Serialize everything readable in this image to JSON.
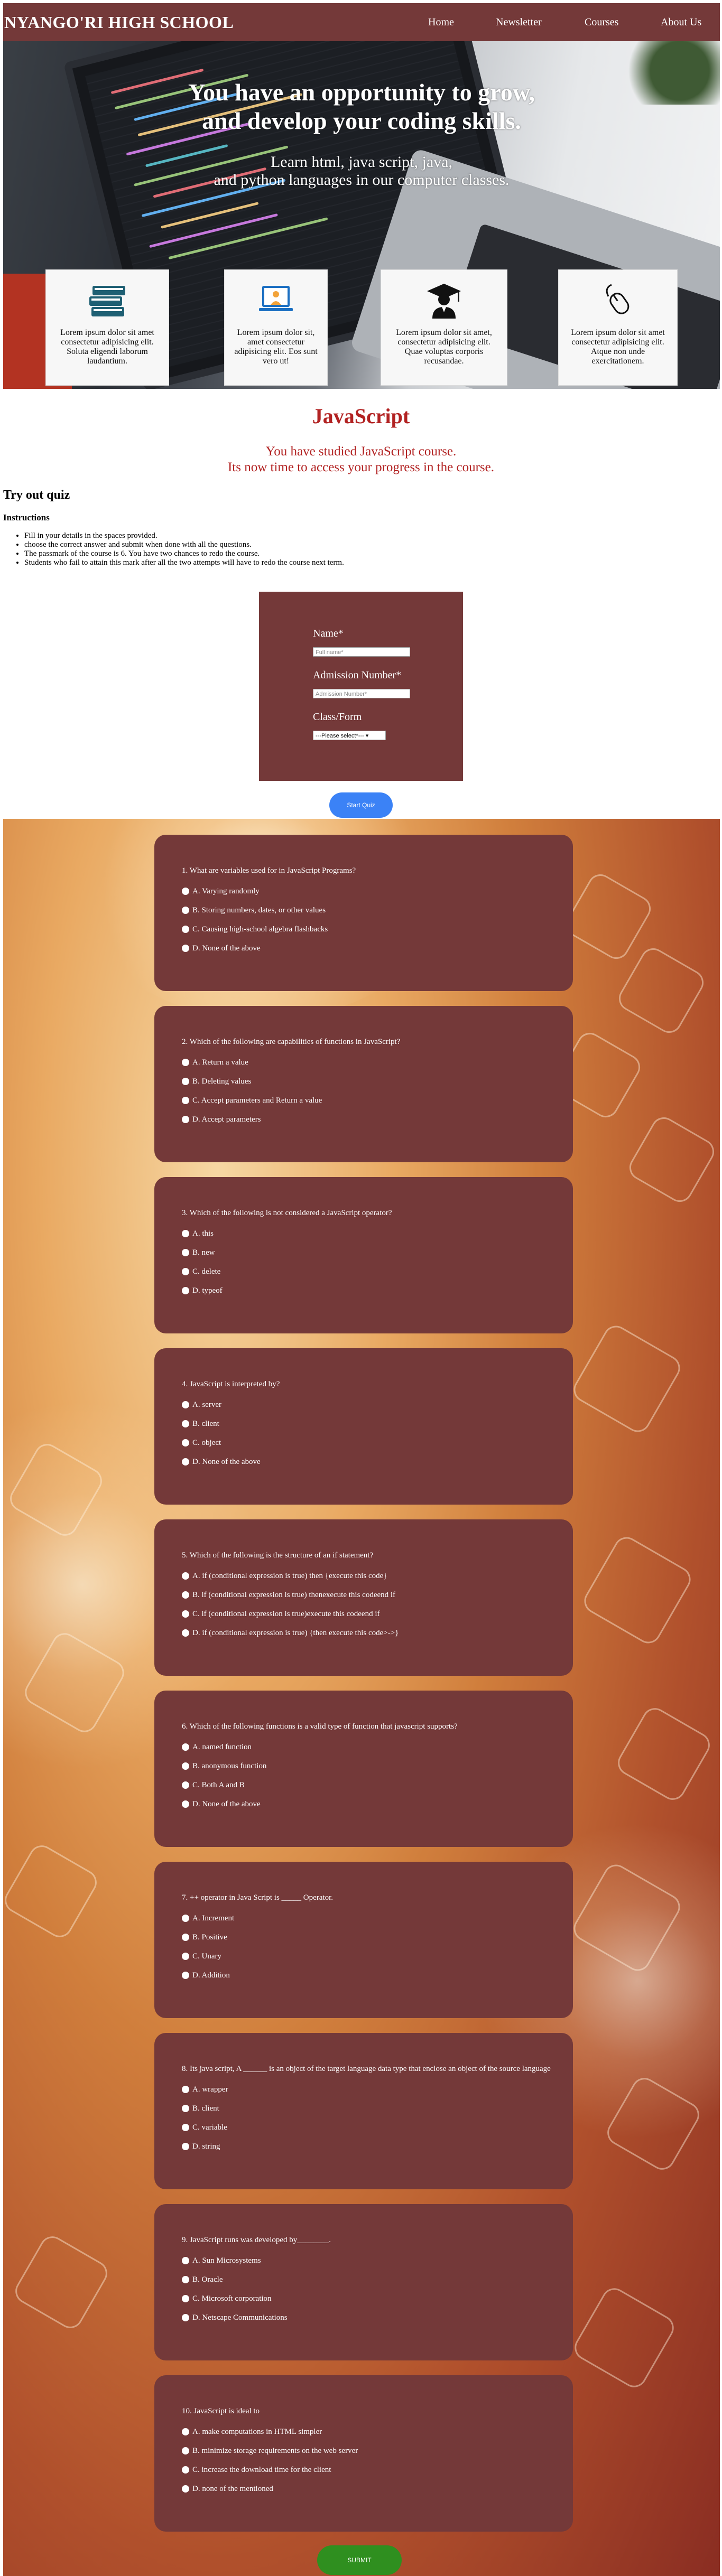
{
  "brand": "NYANGO'RI HIGH SCHOOL",
  "nav": [
    "Home",
    "Newsletter",
    "Courses",
    "About Us"
  ],
  "hero": {
    "title_line1": "You have an opportunity to grow,",
    "title_line2": "and develop your coding skills.",
    "sub_line1": "Learn html, java script, java,",
    "sub_line2": "and python languages in our computer classes."
  },
  "cards": [
    {
      "icon": "books-icon",
      "text": "Lorem ipsum dolor sit amet consectetur adipisicing elit. Soluta eligendi laborum laudantium."
    },
    {
      "icon": "computer-teacher-icon",
      "text": "Lorem ipsum dolor sit, amet consectetur adipisicing elit. Eos sunt vero ut!"
    },
    {
      "icon": "graduate-icon",
      "text": "Lorem ipsum dolor sit amet, consectetur adipisicing elit. Quae voluptas corporis recusandae."
    },
    {
      "icon": "mouse-icon",
      "text": "Lorem ipsum dolor sit amet consectetur adipisicing elit. Atque non unde exercitationem."
    }
  ],
  "course": {
    "title": "JavaScript",
    "sub1": "You have studied JavaScript course.",
    "sub2": "Its now time to access your progress in the course."
  },
  "try_title": "Try out quiz",
  "instructions_title": "Instructions",
  "instructions": [
    "Fill in your details in the spaces provided.",
    "choose the correct answer and submit when done with all the questions.",
    "The passmark of the course is 6. You have two chances to redo the course.",
    "Students who fail to attain this mark after all the two attempts will have to redo the course next term."
  ],
  "form": {
    "name_label": "Name*",
    "name_placeholder": "Full name*",
    "adm_label": "Admission Number*",
    "adm_placeholder": "Admission Number*",
    "class_label": "Class/Form",
    "class_value": "---Please select*---"
  },
  "start_label": "Start Quiz",
  "questions": [
    {
      "q": "1. What are variables used for in JavaScript Programs?",
      "opts": [
        "A. Varying randomly",
        "B. Storing numbers, dates, or other values",
        "C. Causing high-school algebra flashbacks",
        "D. None of the above"
      ]
    },
    {
      "q": "2. Which of the following are capabilities of functions in JavaScript?",
      "opts": [
        "A. Return a value",
        "B. Deleting values",
        "C. Accept parameters and Return a value",
        "D. Accept parameters"
      ]
    },
    {
      "q": "3. Which of the following is not considered a JavaScript operator?",
      "opts": [
        "A. this",
        "B. new",
        "C. delete",
        "D. typeof"
      ]
    },
    {
      "q": "4. JavaScript is interpreted by?",
      "opts": [
        "A. server",
        "B. client",
        "C. object",
        "D. None of the above"
      ]
    },
    {
      "q": "5. Which of the following is the structure of an if statement?",
      "opts": [
        "A. if (conditional expression is true) then {execute this code}",
        "B. if (conditional expression is true) thenexecute this codeend if",
        "C. if (conditional expression is true)execute this codeend if",
        "D. if (conditional expression is true) {then execute this code>->}"
      ]
    },
    {
      "q": "6. Which of the following functions is a valid type of function that javascript supports?",
      "opts": [
        "A. named function",
        "B. anonymous function",
        "C. Both A and B",
        "D. None of the above"
      ]
    },
    {
      "q": "7. ++ operator in Java Script is _____ Operator.",
      "opts": [
        "A. Increment",
        "B. Positive",
        "C. Unary",
        "D. Addition"
      ]
    },
    {
      "q": "8. Its java script, A ______ is an object of the target language data type that enclose an object of the source language",
      "opts": [
        "A. wrapper",
        "B. client",
        "C. variable",
        "D. string"
      ]
    },
    {
      "q": "9. JavaScript runs was developed by________.",
      "opts": [
        "A. Sun Microsystems",
        "B. Oracle",
        "C. Microsoft corporation",
        "D. Netscape Communications"
      ]
    },
    {
      "q": "10. JavaScript is ideal to",
      "opts": [
        "A. make computations in HTML simpler",
        "B. minimize storage requirements on the web server",
        "C. increase the download time for the client",
        "D. none of the mentioned"
      ]
    }
  ],
  "submit_label": "SUBMIT",
  "colors": {
    "maroon": "#743939",
    "heading_red": "#b22222",
    "start_blue": "#3b82f6",
    "submit_green": "#2f8f1f"
  }
}
